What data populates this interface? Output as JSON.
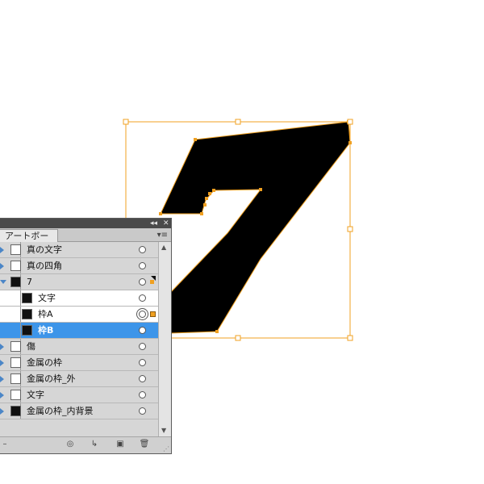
{
  "canvas": {
    "glyph_fill": "#000000",
    "selection_color": "#f0a020"
  },
  "panel": {
    "tab_label": "アートボード",
    "collapse_glyph": "◂◂",
    "close_glyph": "✕",
    "menu_glyph": "▾≡",
    "layers": [
      {
        "label": "真の文字",
        "icon": "text-thumb-icon",
        "shade": "gray",
        "expanded": false,
        "level": 0
      },
      {
        "label": "真の四角",
        "icon": "square-thumb-icon",
        "shade": "gray",
        "expanded": false,
        "level": 0
      },
      {
        "label": "7",
        "icon": "seven-thumb-icon",
        "shade": "gray",
        "expanded": true,
        "level": 0
      },
      {
        "label": "文字",
        "icon": "seven-thumb-icon",
        "shade": "light",
        "level": 1
      },
      {
        "label": "枠A",
        "icon": "seven-thumb-icon",
        "shade": "light",
        "level": 1
      },
      {
        "label": "枠B",
        "icon": "seven-thumb-icon",
        "shade": "selected",
        "level": 1
      },
      {
        "label": "傷",
        "icon": "scratch-thumb-icon",
        "shade": "gray",
        "expanded": false,
        "level": 0
      },
      {
        "label": "金属の枠",
        "icon": "frame-thumb-icon",
        "shade": "gray",
        "expanded": false,
        "level": 0
      },
      {
        "label": "金属の枠_外",
        "icon": "frame-thumb-icon",
        "shade": "gray",
        "expanded": false,
        "level": 0
      },
      {
        "label": "文字",
        "icon": "text-thumb-icon",
        "shade": "gray",
        "expanded": false,
        "level": 0
      },
      {
        "label": "金属の枠_内背景",
        "icon": "dark-frame-thumb-icon",
        "shade": "gray",
        "expanded": false,
        "level": 0
      }
    ],
    "footer_buttons": [
      "make-clipping-mask-icon",
      "new-sublayer-icon",
      "new-layer-icon",
      "trash-icon"
    ]
  }
}
